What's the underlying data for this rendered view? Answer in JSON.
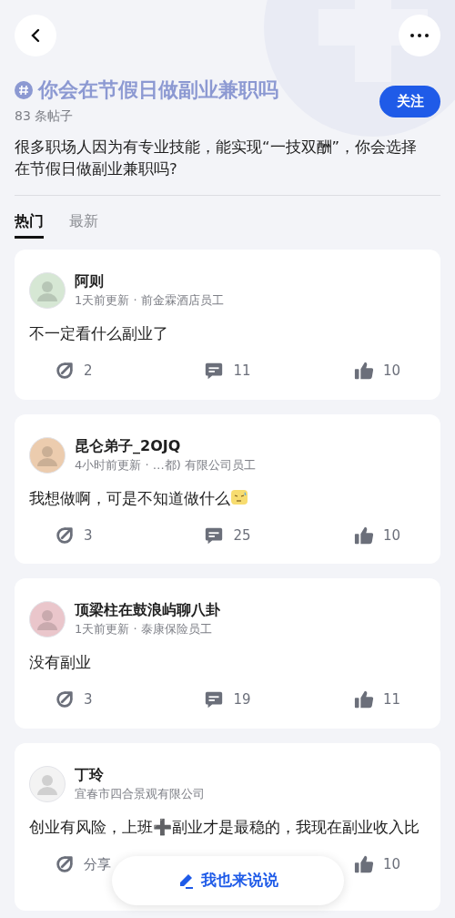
{
  "topic": {
    "title": "你会在节假日做副业兼职吗",
    "post_count": "83 条帖子",
    "follow_label": "关注",
    "description": "很多职场人因为有专业技能，能实现“一技双酬”，你会选择在节假日做副业兼职吗?"
  },
  "tabs": [
    {
      "label": "热门",
      "selected": true
    },
    {
      "label": "最新",
      "selected": false
    }
  ],
  "posts": [
    {
      "author": "阿则",
      "meta": "1天前更新 · 前金霖酒店员工",
      "body": "不一定看什么副业了",
      "emoji": false,
      "avatar": {
        "color": "#d6e7d4"
      },
      "share": "2",
      "comments": "11",
      "likes": "10"
    },
    {
      "author": "昆仑弟子_2OJQ",
      "meta": "4小时前更新 · …都) 有限公司员工",
      "body": "我想做啊，可是不知道做什么",
      "emoji": true,
      "avatar": {
        "color": "#ecccae"
      },
      "share": "3",
      "comments": "25",
      "likes": "10"
    },
    {
      "author": "顶梁柱在鼓浪屿聊八卦",
      "meta": "1天前更新 · 泰康保险员工",
      "body": "没有副业",
      "emoji": false,
      "avatar": {
        "color": "#eac6cb"
      },
      "share": "3",
      "comments": "19",
      "likes": "11"
    },
    {
      "author": "丁玲",
      "meta": "宜春市四合景观有限公司",
      "body": "创业有风险，上班➕副业才是最稳的，我现在副业收入比",
      "emoji": false,
      "avatar": {
        "color": "#f3f3f3"
      },
      "share": "分享",
      "likes": "10"
    }
  ],
  "compose_label": "我也来说说"
}
